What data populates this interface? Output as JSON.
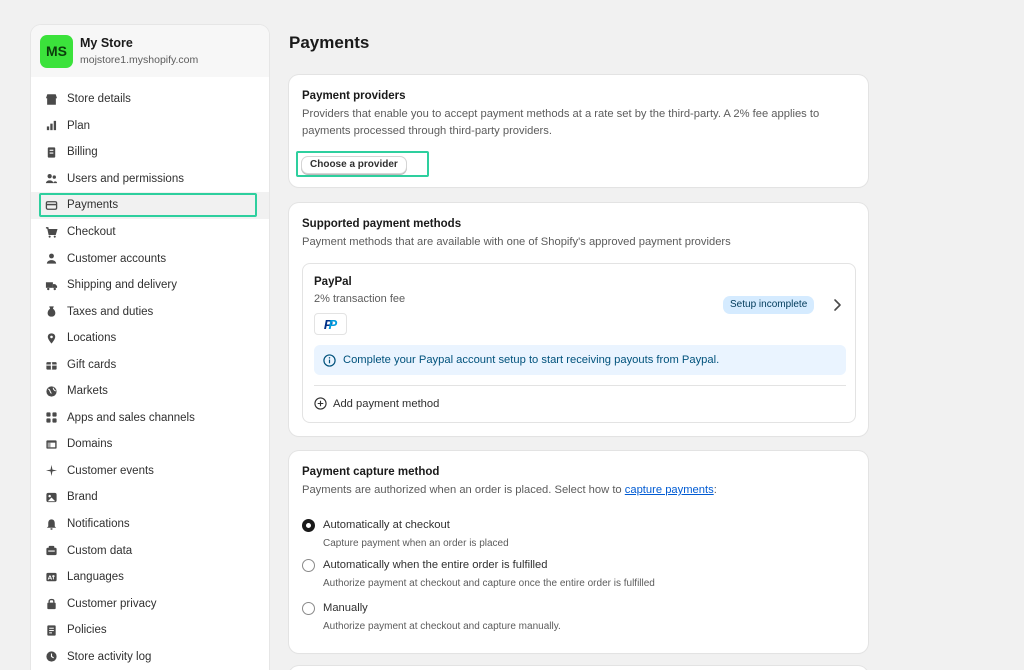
{
  "store": {
    "initials": "MS",
    "name": "My Store",
    "url": "mojstore1.myshopify.com",
    "avatar_color": "#3be23b"
  },
  "sidebar": {
    "items": [
      {
        "label": "Store details",
        "icon": "store-icon"
      },
      {
        "label": "Plan",
        "icon": "chart-icon"
      },
      {
        "label": "Billing",
        "icon": "receipt-icon"
      },
      {
        "label": "Users and permissions",
        "icon": "users-icon"
      },
      {
        "label": "Payments",
        "icon": "payment-icon",
        "active": true
      },
      {
        "label": "Checkout",
        "icon": "cart-icon"
      },
      {
        "label": "Customer accounts",
        "icon": "person-icon"
      },
      {
        "label": "Shipping and delivery",
        "icon": "truck-icon"
      },
      {
        "label": "Taxes and duties",
        "icon": "tax-icon"
      },
      {
        "label": "Locations",
        "icon": "location-icon"
      },
      {
        "label": "Gift cards",
        "icon": "gift-icon"
      },
      {
        "label": "Markets",
        "icon": "globe-icon"
      },
      {
        "label": "Apps and sales channels",
        "icon": "apps-icon"
      },
      {
        "label": "Domains",
        "icon": "domain-icon"
      },
      {
        "label": "Customer events",
        "icon": "sparkle-icon"
      },
      {
        "label": "Brand",
        "icon": "brand-icon"
      },
      {
        "label": "Notifications",
        "icon": "bell-icon"
      },
      {
        "label": "Custom data",
        "icon": "database-icon"
      },
      {
        "label": "Languages",
        "icon": "language-icon"
      },
      {
        "label": "Customer privacy",
        "icon": "lock-icon"
      },
      {
        "label": "Policies",
        "icon": "policy-icon"
      },
      {
        "label": "Store activity log",
        "icon": "activity-icon"
      }
    ]
  },
  "page": {
    "title": "Payments"
  },
  "providers": {
    "title": "Payment providers",
    "description": "Providers that enable you to accept payment methods at a rate set by the third-party. A 2% fee applies to payments processed through third-party providers.",
    "button": "Choose a provider"
  },
  "supported": {
    "title": "Supported payment methods",
    "description": "Payment methods that are available with one of Shopify's approved payment providers",
    "method": {
      "name": "PayPal",
      "fee": "2% transaction fee",
      "logo": "paypal-logo",
      "status": "Setup incomplete",
      "banner": "Complete your Paypal account setup to start receiving payouts from Paypal."
    },
    "add_label": "Add payment method"
  },
  "capture": {
    "title": "Payment capture method",
    "description_prefix": "Payments are authorized when an order is placed. Select how to ",
    "description_link": "capture payments",
    "description_suffix": ":",
    "options": [
      {
        "label": "Automatically at checkout",
        "help": "Capture payment when an order is placed",
        "checked": true
      },
      {
        "label": "Automatically when the entire order is fulfilled",
        "help": "Authorize payment at checkout and capture once the entire order is fulfilled",
        "checked": false
      },
      {
        "label": "Manually",
        "help": "Authorize payment at checkout and capture manually.",
        "checked": false
      }
    ]
  },
  "colors": {
    "highlight": "#2ecf9e",
    "badge_bg": "#d5ebff",
    "banner_bg": "#eaf4ff",
    "link": "#005bd3"
  }
}
